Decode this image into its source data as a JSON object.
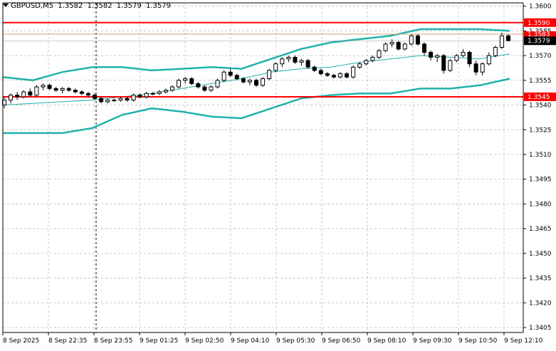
{
  "header": {
    "symbol": "GBPUSD,M5",
    "open": "1.3582",
    "high": "1.3582",
    "low": "1.3579",
    "close": "1.3579"
  },
  "colors": {
    "background": "#ffffff",
    "grid": "#c8c8c8",
    "candle": "#000000",
    "bands": "#20b2aa",
    "level_line": "#ff0000",
    "price_line": "#d2a070"
  },
  "chart_data": {
    "type": "candlestick",
    "symbol": "GBPUSD",
    "timeframe": "M5",
    "ylim": [
      1.34,
      1.36
    ],
    "y_ticks": [
      "1.3600",
      "1.3585",
      "1.3570",
      "1.3555",
      "1.3540",
      "1.3525",
      "1.3510",
      "1.3495",
      "1.3480",
      "1.3465",
      "1.3450",
      "1.3435",
      "1.3420",
      "1.3405"
    ],
    "x_ticks": [
      "8 Sep 2025",
      "8 Sep 22:35",
      "8 Sep 23:55",
      "9 Sep 01:25",
      "9 Sep 02:50",
      "9 Sep 04:10",
      "9 Sep 05:30",
      "9 Sep 06:50",
      "9 Sep 08:10",
      "9 Sep 09:30",
      "9 Sep 10:50",
      "9 Sep 12:10"
    ],
    "horizontal_levels": [
      {
        "value": 1.359,
        "label": "1.3590",
        "color": "#ff0000"
      },
      {
        "value": 1.3545,
        "label": "1.3545",
        "color": "#ff0000"
      }
    ],
    "current_price": {
      "value": 1.3579,
      "label": "1.3579"
    },
    "ask_price": {
      "value": 1.3583,
      "label": "1.3583"
    },
    "candles_ohlc": [
      [
        1.354,
        1.3545,
        1.3538,
        1.3543
      ],
      [
        1.3543,
        1.3547,
        1.3541,
        1.3546
      ],
      [
        1.3546,
        1.3548,
        1.3543,
        1.3545
      ],
      [
        1.3545,
        1.3549,
        1.3544,
        1.3548
      ],
      [
        1.3548,
        1.355,
        1.3545,
        1.3546
      ],
      [
        1.3546,
        1.3552,
        1.3545,
        1.3551
      ],
      [
        1.3551,
        1.3553,
        1.3549,
        1.3552
      ],
      [
        1.3552,
        1.3553,
        1.3549,
        1.355
      ],
      [
        1.355,
        1.3551,
        1.3548,
        1.3549
      ],
      [
        1.3549,
        1.3551,
        1.3547,
        1.355
      ],
      [
        1.355,
        1.3551,
        1.3548,
        1.3549
      ],
      [
        1.3549,
        1.355,
        1.3547,
        1.3548
      ],
      [
        1.3548,
        1.3549,
        1.3546,
        1.3547
      ],
      [
        1.3547,
        1.3548,
        1.3545,
        1.3546
      ],
      [
        1.3546,
        1.3547,
        1.3543,
        1.3544
      ],
      [
        1.3544,
        1.3545,
        1.3541,
        1.3542
      ],
      [
        1.3542,
        1.3544,
        1.3541,
        1.3543
      ],
      [
        1.3543,
        1.3544,
        1.3542,
        1.3543
      ],
      [
        1.3543,
        1.3545,
        1.3542,
        1.3544
      ],
      [
        1.3544,
        1.3545,
        1.3542,
        1.3543
      ],
      [
        1.3543,
        1.3547,
        1.3542,
        1.3546
      ],
      [
        1.3546,
        1.3547,
        1.3544,
        1.3545
      ],
      [
        1.3545,
        1.3548,
        1.3544,
        1.3547
      ],
      [
        1.3547,
        1.3548,
        1.3546,
        1.3547
      ],
      [
        1.3547,
        1.3549,
        1.3546,
        1.3548
      ],
      [
        1.3548,
        1.355,
        1.3547,
        1.3549
      ],
      [
        1.3549,
        1.3552,
        1.3548,
        1.3551
      ],
      [
        1.3551,
        1.3556,
        1.355,
        1.3555
      ],
      [
        1.3555,
        1.3557,
        1.3553,
        1.3556
      ],
      [
        1.3556,
        1.3557,
        1.3552,
        1.3553
      ],
      [
        1.3553,
        1.3554,
        1.355,
        1.3551
      ],
      [
        1.3551,
        1.3552,
        1.3548,
        1.3549
      ],
      [
        1.3549,
        1.3552,
        1.3548,
        1.3551
      ],
      [
        1.3551,
        1.3556,
        1.355,
        1.3555
      ],
      [
        1.3555,
        1.3561,
        1.3554,
        1.356
      ],
      [
        1.356,
        1.3562,
        1.3557,
        1.3558
      ],
      [
        1.3558,
        1.3559,
        1.3555,
        1.3556
      ],
      [
        1.3556,
        1.3557,
        1.3553,
        1.3554
      ],
      [
        1.3554,
        1.3556,
        1.3552,
        1.3555
      ],
      [
        1.3555,
        1.3556,
        1.3551,
        1.3552
      ],
      [
        1.3552,
        1.3557,
        1.3551,
        1.3556
      ],
      [
        1.3556,
        1.3562,
        1.3555,
        1.3561
      ],
      [
        1.3561,
        1.3566,
        1.356,
        1.3565
      ],
      [
        1.3565,
        1.3569,
        1.3563,
        1.3568
      ],
      [
        1.3568,
        1.357,
        1.3566,
        1.3569
      ],
      [
        1.3569,
        1.357,
        1.3565,
        1.3566
      ],
      [
        1.3566,
        1.3568,
        1.3564,
        1.3567
      ],
      [
        1.3567,
        1.3568,
        1.3562,
        1.3563
      ],
      [
        1.3563,
        1.3564,
        1.356,
        1.3561
      ],
      [
        1.3561,
        1.3562,
        1.3558,
        1.3559
      ],
      [
        1.3559,
        1.356,
        1.3557,
        1.3558
      ],
      [
        1.3558,
        1.3559,
        1.3556,
        1.3557
      ],
      [
        1.3557,
        1.356,
        1.3556,
        1.3559
      ],
      [
        1.3559,
        1.356,
        1.3556,
        1.3557
      ],
      [
        1.3557,
        1.3564,
        1.3556,
        1.3563
      ],
      [
        1.3563,
        1.3566,
        1.3562,
        1.3565
      ],
      [
        1.3565,
        1.3568,
        1.3564,
        1.3567
      ],
      [
        1.3567,
        1.357,
        1.3566,
        1.3569
      ],
      [
        1.3569,
        1.3574,
        1.3568,
        1.3573
      ],
      [
        1.3573,
        1.3578,
        1.3572,
        1.3577
      ],
      [
        1.3577,
        1.358,
        1.3575,
        1.3578
      ],
      [
        1.3578,
        1.3579,
        1.3573,
        1.3574
      ],
      [
        1.3574,
        1.3578,
        1.3573,
        1.3577
      ],
      [
        1.3577,
        1.3583,
        1.3576,
        1.3582
      ],
      [
        1.3582,
        1.3583,
        1.3576,
        1.3577
      ],
      [
        1.3577,
        1.3578,
        1.357,
        1.3572
      ],
      [
        1.3572,
        1.3573,
        1.3567,
        1.3569
      ],
      [
        1.3569,
        1.3571,
        1.3566,
        1.357
      ],
      [
        1.357,
        1.3571,
        1.3559,
        1.3561
      ],
      [
        1.3561,
        1.3568,
        1.356,
        1.3567
      ],
      [
        1.3567,
        1.3571,
        1.3566,
        1.357
      ],
      [
        1.357,
        1.3574,
        1.3569,
        1.3572
      ],
      [
        1.3572,
        1.3573,
        1.3563,
        1.3565
      ],
      [
        1.3565,
        1.3567,
        1.3558,
        1.356
      ],
      [
        1.356,
        1.3566,
        1.3558,
        1.3565
      ],
      [
        1.3565,
        1.3572,
        1.3564,
        1.357
      ],
      [
        1.357,
        1.3576,
        1.3569,
        1.3575
      ],
      [
        1.3575,
        1.3584,
        1.3574,
        1.3582
      ],
      [
        1.3582,
        1.3583,
        1.3579,
        1.3579
      ]
    ],
    "bollinger_upper": [
      1.3557,
      1.3555,
      1.356,
      1.3563,
      1.3563,
      1.3561,
      1.3562,
      1.3563,
      1.3562,
      1.3568,
      1.3574,
      1.3578,
      1.358,
      1.3582,
      1.3586,
      1.3586,
      1.3586,
      1.3585
    ],
    "bollinger_middle": [
      1.354,
      1.3541,
      1.3542,
      1.3543,
      1.3545,
      1.3547,
      1.355,
      1.3553,
      1.3556,
      1.356,
      1.3562,
      1.3563,
      1.3566,
      1.3568,
      1.357,
      1.3569,
      1.3568,
      1.3571
    ],
    "bollinger_lower": [
      1.3523,
      1.3523,
      1.3523,
      1.3526,
      1.3534,
      1.3538,
      1.3536,
      1.3533,
      1.3532,
      1.3538,
      1.3544,
      1.3546,
      1.3547,
      1.3547,
      1.355,
      1.355,
      1.3552,
      1.3556
    ]
  }
}
